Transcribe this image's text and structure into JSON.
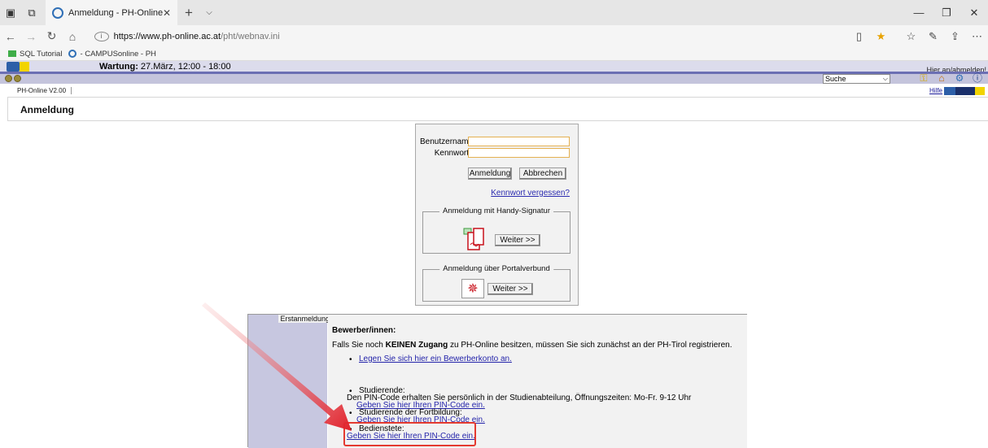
{
  "browser": {
    "tab_title": "Anmeldung - PH-Online",
    "url_host": "https://www.ph-online.ac.at",
    "url_path": "/pht/webnav.ini",
    "favorites": [
      {
        "label": "SQL Tutorial"
      },
      {
        "label": "- CAMPUSonline - PH"
      }
    ]
  },
  "page": {
    "maintenance_label": "Wartung:",
    "maintenance_text": " 27.März, 12:00 - 18:00",
    "login_link": "Hier an/abmelden!",
    "search_select": "Suche",
    "version": "PH-Online V2.00",
    "help_link": "Hilfe",
    "title": "Anmeldung"
  },
  "login": {
    "username_label": "Benutzername",
    "password_label": "Kennwort",
    "username_value": "",
    "password_value": "",
    "login_button": "Anmeldung",
    "cancel_button": "Abbrechen",
    "forgot_link": "Kennwort vergessen?",
    "handy_legend": "Anmeldung mit Handy-Signatur",
    "handy_button": "Weiter >>",
    "portal_legend": "Anmeldung über Portalverbund",
    "portal_button": "Weiter >>"
  },
  "erstanmeldung": {
    "side_label": "Erstanmeldung",
    "heading": "Bewerber/innen:",
    "intro_prefix": "Falls Sie noch ",
    "intro_bold": "KEINEN Zugang",
    "intro_suffix": " zu PH-Online besitzen, müssen Sie sich zunächst an der PH-Tirol registrieren.",
    "bewerber_link": "Legen Sie sich hier ein Bewerberkonto an.",
    "studierende_label": "Studierende:",
    "studierende_text": "Den PIN-Code erhalten Sie persönlich in der Studienabteilung, Öffnungszeiten: Mo-Fr. 9-12 Uhr",
    "studierende_link": "Geben Sie hier Ihren PIN-Code ein.",
    "fortbildung_label": "Studierende der Fortbildung:",
    "fortbildung_link": "Geben Sie hier Ihren PIN-Code ein.",
    "bedienstete_label": "Bedienstete:",
    "bedienstete_link": "Geben Sie hier Ihren PIN-Code ein."
  },
  "colors": {
    "annotation_red": "#e43a30",
    "sidebar_lavender": "#c7c7e0",
    "header_blue": "#6b6fb3"
  }
}
